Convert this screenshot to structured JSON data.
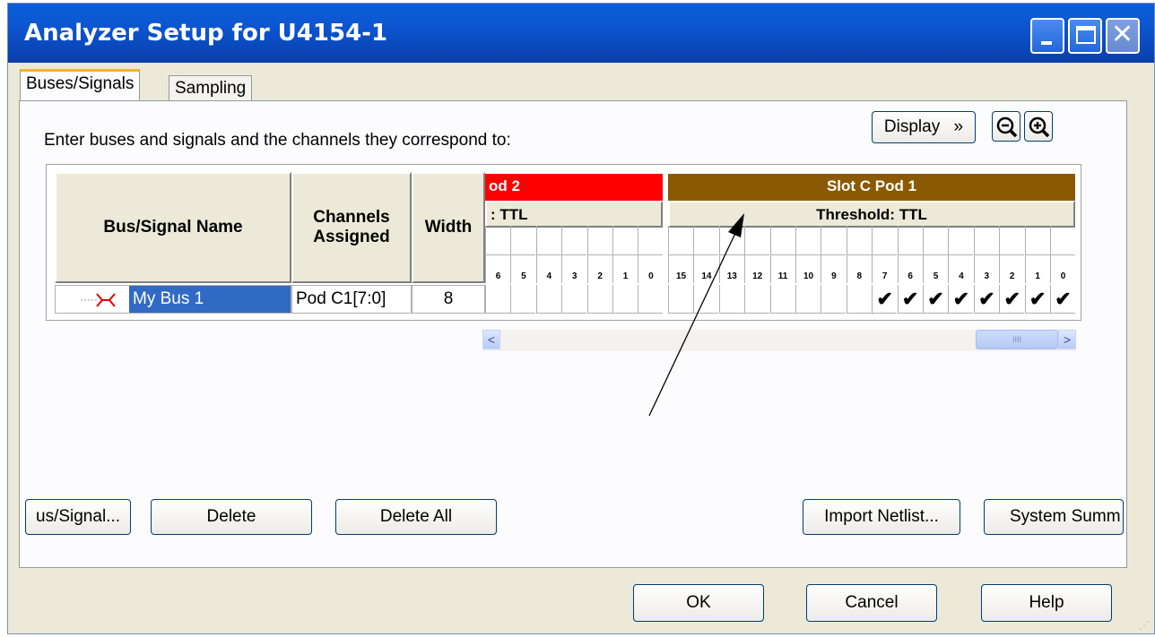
{
  "window": {
    "title": "Analyzer Setup for U4154-1",
    "controls": {
      "minimize": "minimize",
      "maximize": "maximize",
      "close": "close"
    }
  },
  "tabs": [
    {
      "label": "Buses/Signals",
      "active": true
    },
    {
      "label": "Sampling",
      "active": false
    }
  ],
  "instructions": "Enter buses and signals and the channels they correspond to:",
  "toolbar": {
    "display_label": "Display",
    "display_chevron": "»",
    "zoom_out_icon": "zoom-out-icon",
    "zoom_in_icon": "zoom-in-icon"
  },
  "grid": {
    "headers": {
      "name": "Bus/Signal Name",
      "channels": "Channels Assigned",
      "width": "Width"
    },
    "pods": [
      {
        "label": "od 2",
        "color": "#ff0000",
        "threshold": ": TTL",
        "channels": [
          "6",
          "5",
          "4",
          "3",
          "2",
          "1",
          "0"
        ]
      },
      {
        "label": "Slot C Pod 1",
        "color": "#8b5a00",
        "threshold": "Threshold: TTL",
        "channels": [
          "15",
          "14",
          "13",
          "12",
          "11",
          "10",
          "9",
          "8",
          "7",
          "6",
          "5",
          "4",
          "3",
          "2",
          "1",
          "0"
        ]
      }
    ],
    "rows": [
      {
        "name": "My Bus 1",
        "channels": "Pod C1[7:0]",
        "width": "8",
        "pod2_checks": [
          false,
          false,
          false,
          false,
          false,
          false,
          false
        ],
        "pod1_checks": [
          false,
          false,
          false,
          false,
          false,
          false,
          false,
          false,
          true,
          true,
          true,
          true,
          true,
          true,
          true,
          true
        ]
      }
    ],
    "check_glyph": "✔"
  },
  "scrollbar": {
    "left": "<",
    "right": ">",
    "thumb_grip": "IIII"
  },
  "buttons": {
    "add": "us/Signal...",
    "delete": "Delete",
    "delete_all": "Delete All",
    "import_netlist": "Import Netlist...",
    "system_summary": "System Summ"
  },
  "footer": {
    "ok": "OK",
    "cancel": "Cancel",
    "help": "Help"
  }
}
